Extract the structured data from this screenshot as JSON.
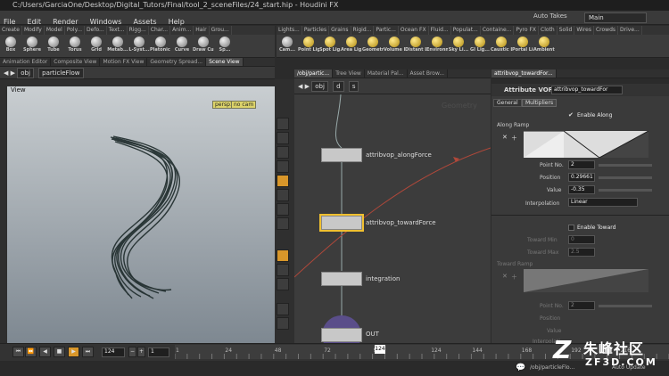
{
  "title": "C:/Users/GarciaOne/Desktop/Digital_Tutors/Final/tool_2_sceneFiles/24_start.hip - Houdini FX",
  "menu": [
    "File",
    "Edit",
    "Render",
    "Windows",
    "Assets",
    "Help"
  ],
  "desktop": {
    "auto_takes": "Auto Takes",
    "main": "Main"
  },
  "shelf_left": {
    "tabs": [
      "Create",
      "Modify",
      "Model",
      "Poly...",
      "Defo...",
      "Text...",
      "Rigg...",
      "Char...",
      "Anim...",
      "Hair",
      "Grou..."
    ],
    "tools": [
      "Box",
      "Sphere",
      "Tube",
      "Torus",
      "Grid",
      "Metab...",
      "L-Syst...",
      "Platonic Sol...",
      "Curve",
      "Draw Cur...",
      "Sp..."
    ]
  },
  "shelf_right": {
    "tabs": [
      "Lights...",
      "Particles",
      "Grains",
      "Rigid...",
      "Partic...",
      "Ocean FX",
      "Fluid...",
      "Populat...",
      "Containe...",
      "Pyro FX",
      "Cloth",
      "Solid",
      "Wires",
      "Crowds",
      "Drive..."
    ],
    "tools": [
      "Cam...",
      "Point Lig...",
      "Spot Lig...",
      "Area Lig...",
      "Geometry L...",
      "Volume Lig...",
      "Distant Lig...",
      "Environme...",
      "Sky Li...",
      "GI Lig...",
      "Caustic Li...",
      "Portal Lig...",
      "Ambient Lig..."
    ]
  },
  "left_pane": {
    "tabs": [
      "Animation Editor",
      "Composite View",
      "Motion FX View",
      "Geometry Spread...",
      "Scene View"
    ],
    "path": [
      "obj",
      "particleFlow"
    ],
    "view_label": "View",
    "persp": "persp1",
    "cam": "no cam"
  },
  "mid_pane": {
    "tabs": [
      "/obj/partic...",
      "Tree View",
      "Material Pal...",
      "Asset Brow..."
    ],
    "path": [
      "obj",
      "d",
      "s"
    ],
    "context_label": "Geometry",
    "nodes": [
      "attribvop_alongForce",
      "attribvop_towardForce",
      "integration",
      "OUT"
    ]
  },
  "params": {
    "tab_path": "attribvop_towardFor...",
    "node_type": "Attribute VOP",
    "node_name": "attribvop_towardFor",
    "tabs": [
      "General",
      "Multipliers"
    ],
    "enable_along": "Enable Along",
    "along_ramp": "Along Ramp",
    "point_no_label": "Point No.",
    "point_no": "2",
    "position_label": "Position",
    "position": "0.29661",
    "value_label": "Value",
    "value": "-0.35",
    "interp_label": "Interpolation",
    "interp": "Linear",
    "enable_toward": "Enable Toward",
    "toward_min_label": "Toward Min",
    "toward_min": "0",
    "toward_max_label": "Toward Max",
    "toward_max": "2.5",
    "toward_ramp": "Toward Ramp",
    "point_no2": "2",
    "position2_label": "Position",
    "value2_label": "Value",
    "interp2_label": "Interpolati..."
  },
  "timeline": {
    "frame": "124",
    "step": "1",
    "ticks": [
      "1",
      "24",
      "48",
      "72",
      "96",
      "124",
      "144",
      "168",
      "192",
      "216"
    ],
    "current_frame": 124,
    "range": [
      1,
      240
    ]
  },
  "status": {
    "path": "/obj/particleFlo...",
    "auto_update": "Auto Update"
  },
  "watermark": {
    "logo": "Z",
    "text_cn": "朱峰社区",
    "site": "ZF3D.COM"
  },
  "colors": {
    "accent": "#d8962a",
    "node_select": "#f0c030",
    "viewport_top": "#c9ced1",
    "viewport_bottom": "#7e8891"
  }
}
